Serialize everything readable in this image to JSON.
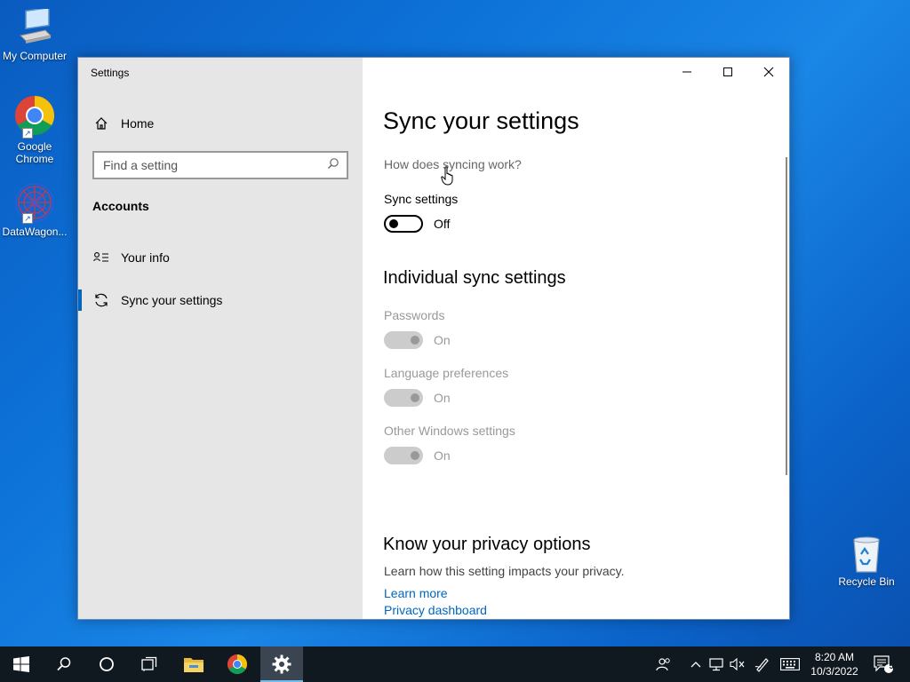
{
  "desktop": {
    "icons": [
      {
        "label": "My Computer"
      },
      {
        "label": "Google Chrome"
      },
      {
        "label": "DataWagon..."
      },
      {
        "label": "Recycle Bin"
      }
    ]
  },
  "window": {
    "title": "Settings",
    "sidebar": {
      "home_label": "Home",
      "search_placeholder": "Find a setting",
      "search_value": "",
      "section_title": "Accounts",
      "items": [
        {
          "label": "Your info"
        },
        {
          "label": "Sync your settings",
          "active": true
        }
      ]
    },
    "content": {
      "title": "Sync your settings",
      "how_link": "How does syncing work?",
      "sync_label": "Sync settings",
      "sync_state": "Off",
      "individual_title": "Individual sync settings",
      "individual": [
        {
          "label": "Passwords",
          "state": "On"
        },
        {
          "label": "Language preferences",
          "state": "On"
        },
        {
          "label": "Other Windows settings",
          "state": "On"
        }
      ],
      "privacy_title": "Know your privacy options",
      "privacy_desc": "Learn how this setting impacts your privacy.",
      "learn_more": "Learn more",
      "privacy_dashboard": "Privacy dashboard"
    }
  },
  "taskbar": {
    "time": "8:20 AM",
    "date": "10/3/2022",
    "notification_count": "5"
  },
  "colors": {
    "accent": "#0067c0",
    "sidebar_bg": "#e6e6e6",
    "taskbar_bg": "#101820"
  }
}
